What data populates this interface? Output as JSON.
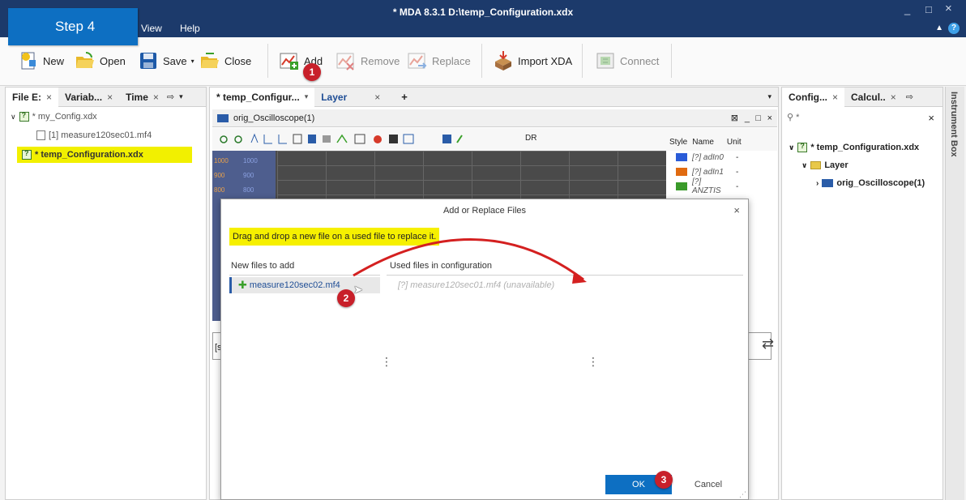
{
  "window": {
    "title": "* MDA 8.3.1  D:\\temp_Configuration.xdx",
    "menu": [
      "View",
      "Help"
    ],
    "minimize": "_",
    "maximize": "□",
    "close": "×",
    "help": "?"
  },
  "step_label": "Step 4",
  "toolbar": {
    "new": "New",
    "open": "Open",
    "save": "Save",
    "close": "Close",
    "add": "Add",
    "remove": "Remove",
    "replace": "Replace",
    "import_xda": "Import XDA",
    "connect": "Connect"
  },
  "left_panel": {
    "tabs": [
      "File E:",
      "Variab...",
      "Time"
    ],
    "tree": [
      {
        "label": "* my_Config.xdx"
      },
      {
        "label": "[1] measure120sec01.mf4"
      },
      {
        "label": "* temp_Configuration.xdx"
      }
    ]
  },
  "center": {
    "tabs": [
      "* temp_Configur...",
      "Layer"
    ],
    "add_tab": "+",
    "window_title": "orig_Oscilloscope(1)",
    "toolbar_text": "DR",
    "axis_values": [
      "1000",
      "900",
      "800"
    ],
    "legend_headers": [
      "Style",
      "Name",
      "Unit"
    ],
    "legend_rows": [
      {
        "name": "[?] adIn0",
        "unit": "-",
        "color": "#2a5cd8"
      },
      {
        "name": "[?] adIn1",
        "unit": "-",
        "color": "#e06a10"
      },
      {
        "name": "[?] ANZTIS",
        "unit": "-",
        "color": "#3a9a2a"
      }
    ],
    "bottom_text": "[s"
  },
  "right_panel": {
    "tabs": [
      "Config...",
      "Calcul.."
    ],
    "search_placeholder": "*",
    "clear": "×",
    "tree": [
      {
        "label": "* temp_Configuration.xdx"
      },
      {
        "label": "Layer"
      },
      {
        "label": "orig_Oscilloscope(1)"
      }
    ],
    "side_tab": "Instrument Box"
  },
  "dialog": {
    "title": "Add or Replace Files",
    "close": "×",
    "hint": "Drag and drop a new file on a used file to replace it.",
    "new_files_header": "New files to add",
    "used_files_header": "Used files in configuration",
    "new_file": "measure120sec02.mf4",
    "used_file": "[?] measure120sec01.mf4 (unavailable)",
    "ok": "OK",
    "cancel": "Cancel"
  },
  "badges": [
    "1",
    "2",
    "3"
  ],
  "colors": {
    "titlebar": "#1c3a6b",
    "accent": "#0d6fc2",
    "badge": "#c8202a",
    "highlight": "#f6f000",
    "arrow": "#d42020"
  }
}
